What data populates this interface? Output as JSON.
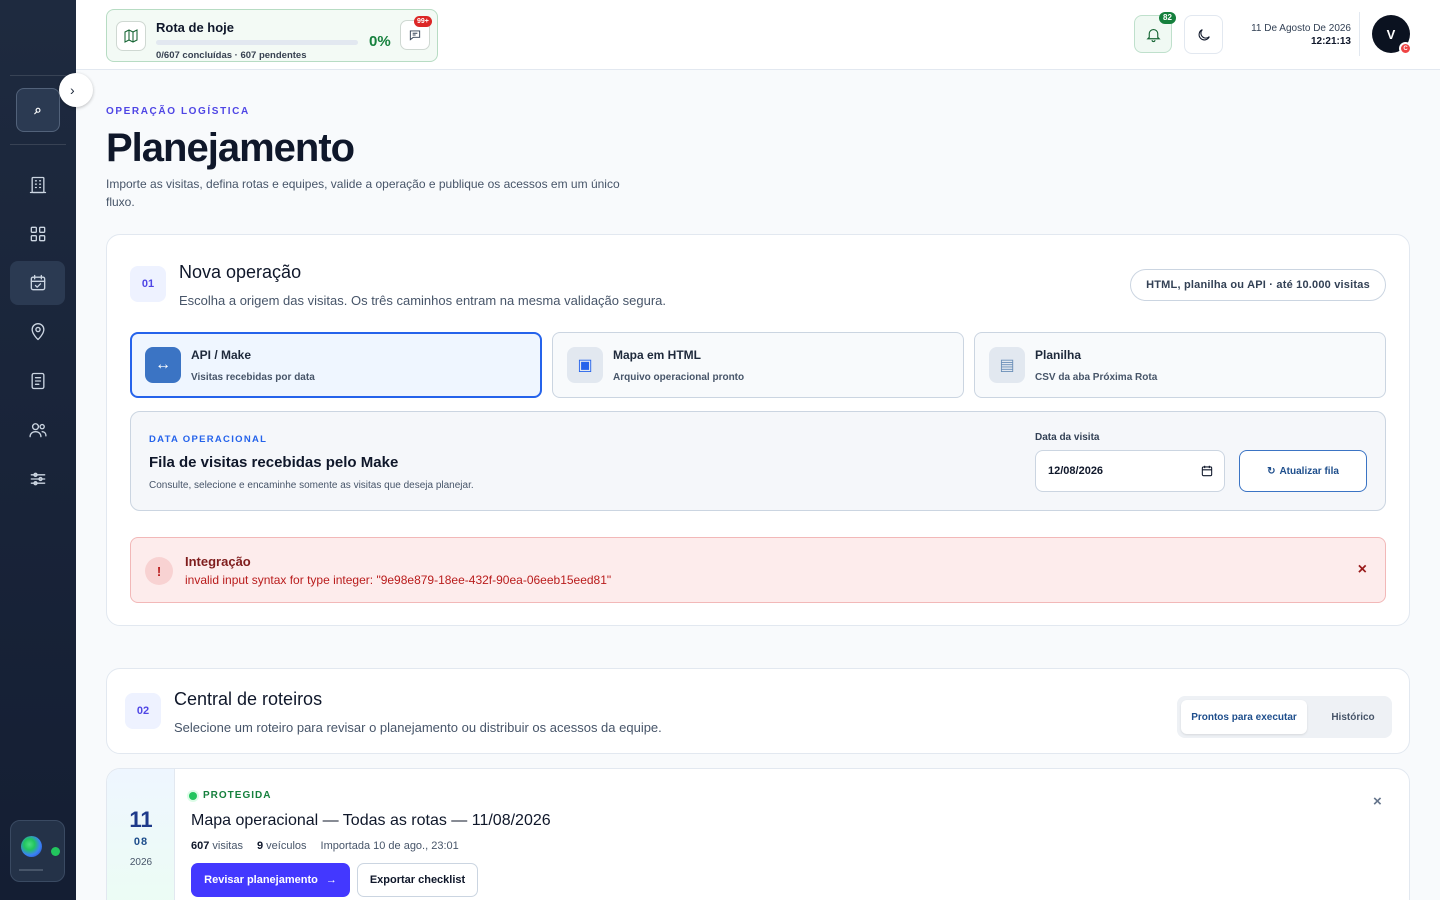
{
  "sidebar": {
    "search_icon": "⌕",
    "collapse_icon": "›",
    "items": [
      {
        "name": "building-icon"
      },
      {
        "name": "grid-icon"
      },
      {
        "name": "calendar-check-icon",
        "active": true
      },
      {
        "name": "map-pin-icon"
      },
      {
        "name": "document-icon"
      },
      {
        "name": "users-icon"
      },
      {
        "name": "sliders-icon"
      }
    ]
  },
  "topbar": {
    "route": {
      "title": "Rota de hoje",
      "progress": 0,
      "summary": "0/607 concluídas · 607 pendentes",
      "percent": "0%",
      "chat_badge": "99+"
    },
    "notifications_count": "82",
    "date": "11 De Agosto De 2026",
    "time": "12:21:13",
    "avatar_initial": "V",
    "avatar_badge": "C"
  },
  "header": {
    "eyebrow": "OPERAÇÃO LOGÍSTICA",
    "title": "Planejamento",
    "description": "Importe as visitas, defina rotas e equipes, valide a operação e publique os acessos em um único fluxo."
  },
  "section1": {
    "step": "01",
    "title": "Nova operação",
    "description": "Escolha a origem das visitas. Os três caminhos entram na mesma validação segura.",
    "pill": "HTML, planilha ou API · até 10.000 visitas",
    "options": [
      {
        "icon": "↔",
        "label": "API / Make",
        "sub": "Visitas recebidas por data",
        "selected": true
      },
      {
        "icon": "▣",
        "label": "Mapa em HTML",
        "sub": "Arquivo operacional pronto",
        "selected": false
      },
      {
        "icon": "▤",
        "label": "Planilha",
        "sub": "CSV da aba Próxima Rota",
        "selected": false
      }
    ],
    "queue": {
      "eyebrow": "DATA OPERACIONAL",
      "title": "Fila de visitas recebidas pelo Make",
      "description": "Consulte, selecione e encaminhe somente as visitas que deseja planejar.",
      "date_label": "Data da visita",
      "date_value": "12/08/2026",
      "refresh_icon": "↻",
      "refresh_label": "Atualizar fila"
    },
    "alert": {
      "icon": "!",
      "title": "Integração",
      "message": "invalid input syntax for type integer: \"9e98e879-18ee-432f-90ea-06eeb15eed81\"",
      "close": "×"
    }
  },
  "section2": {
    "step": "02",
    "title": "Central de roteiros",
    "description": "Selecione um roteiro para revisar o planejamento ou distribuir os acessos da equipe.",
    "tabs": {
      "active": "Prontos para executar",
      "inactive": "Histórico"
    }
  },
  "route_card": {
    "day": "11",
    "month": "08",
    "year": "2026",
    "status": "PROTEGIDA",
    "title": "Mapa operacional — Todas as rotas — 11/08/2026",
    "visits_count": "607",
    "visits_label": "visitas",
    "vehicles_count": "9",
    "vehicles_label": "veículos",
    "imported": "Importada 10 de ago., 23:01",
    "primary_label": "Revisar planejamento",
    "primary_arrow": "→",
    "secondary_label": "Exportar checklist",
    "close": "×"
  },
  "colors": {
    "accent": "#4338ff",
    "success": "#15803d",
    "danger": "#b91c1c",
    "sidebar": "#1e2a3f"
  }
}
